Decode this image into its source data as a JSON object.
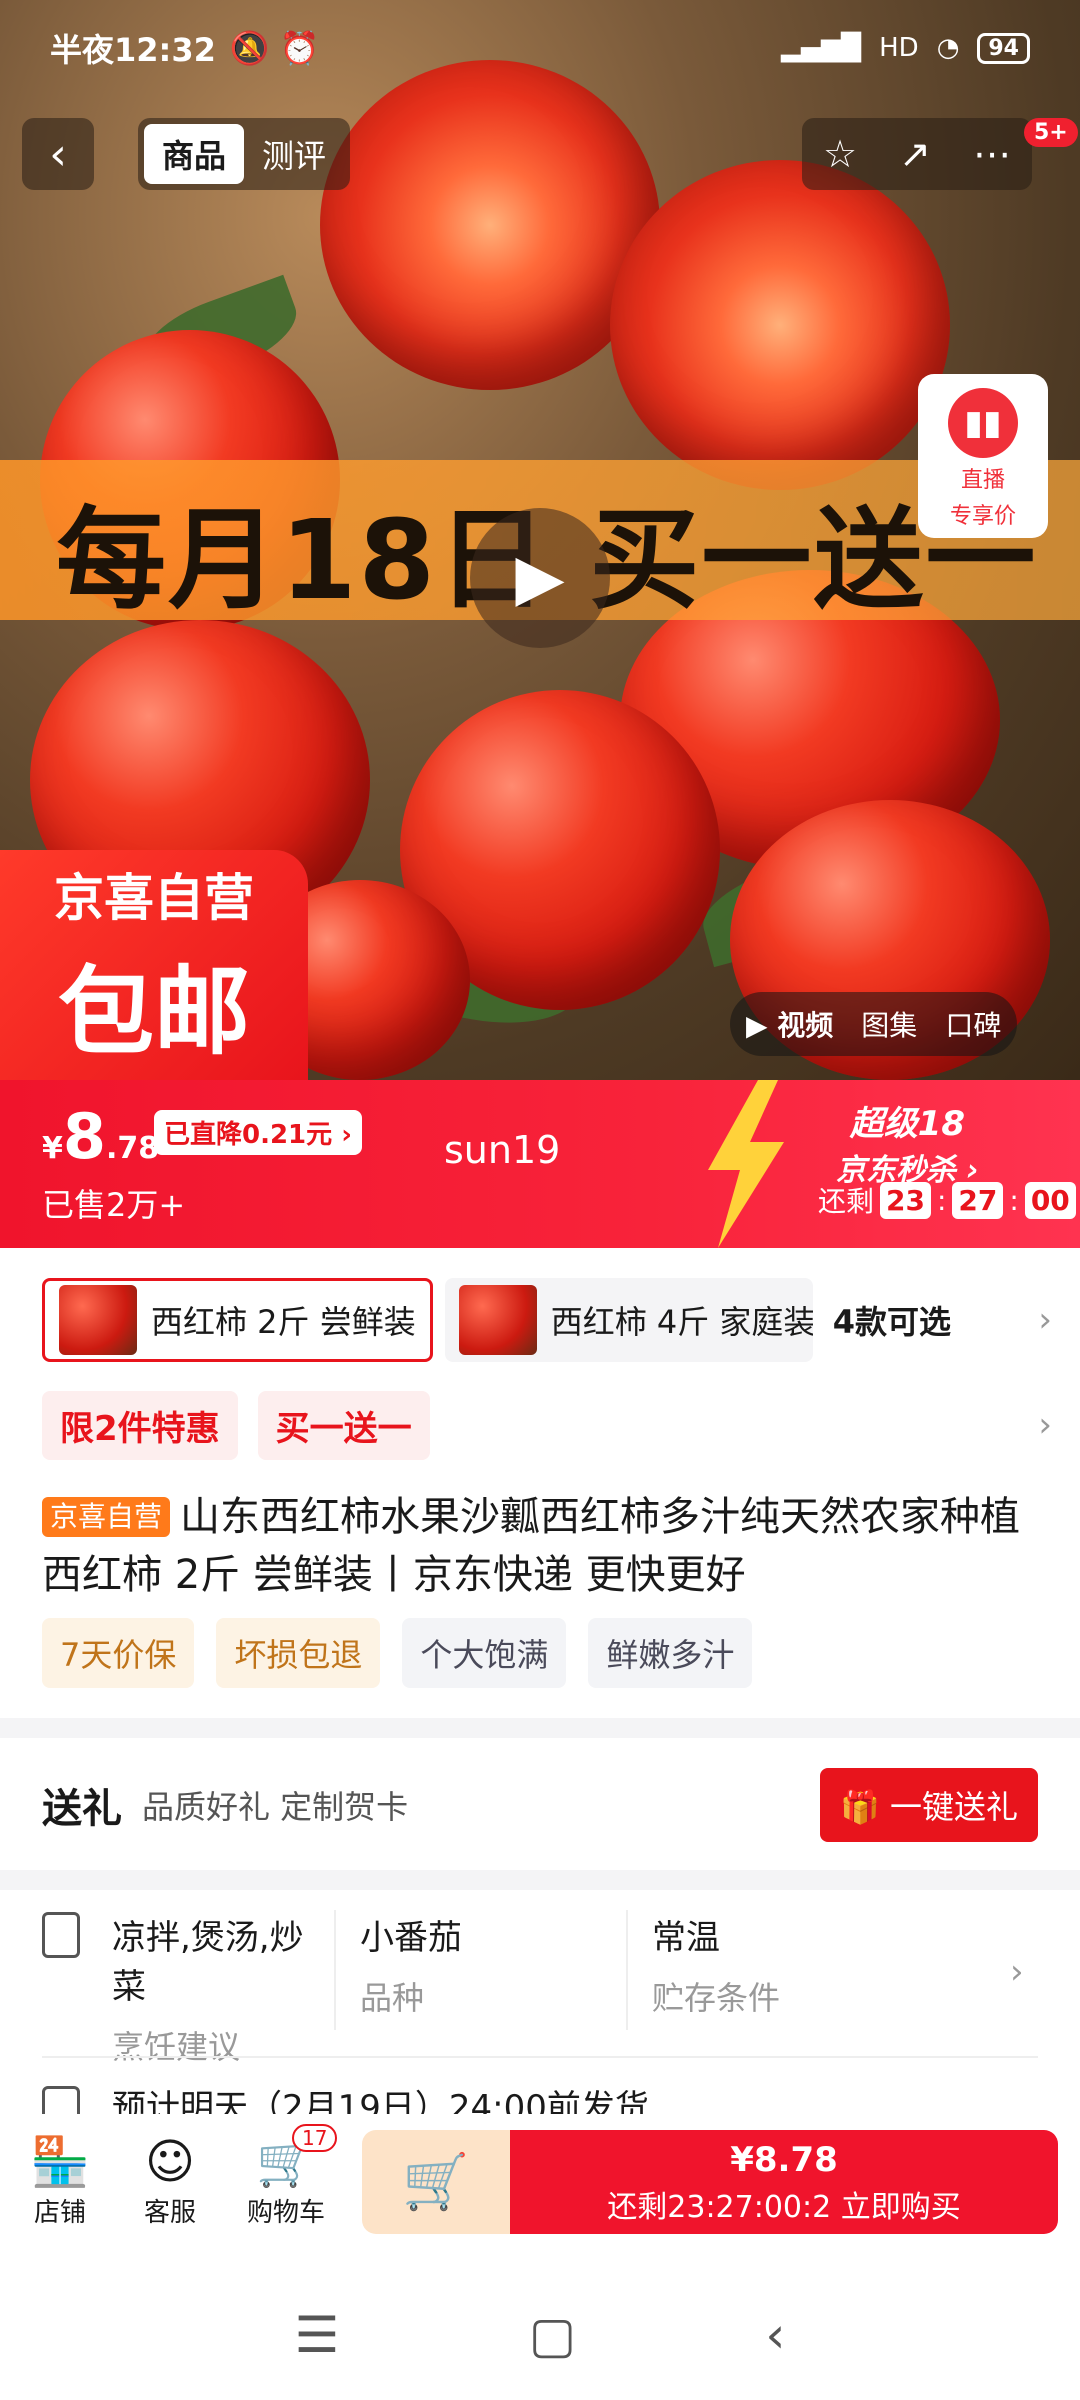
{
  "status_bar": {
    "time": "半夜12:32",
    "battery": "94",
    "signal": "HD"
  },
  "nav": {
    "back": "‹",
    "tabs": [
      "商品",
      "测评"
    ],
    "icons": [
      "star-icon",
      "share-icon",
      "more-icon"
    ],
    "more_badge": "5+"
  },
  "hero": {
    "promo_text": "每月18日 买一送一",
    "live_label_1": "直播",
    "live_label_2": "专享价",
    "corner_badge_1": "京喜自营",
    "corner_badge_2": "包邮",
    "media_tabs": [
      "▶ 视频",
      "图集",
      "口碑"
    ]
  },
  "price": {
    "currency": "¥",
    "integer": "8",
    "decimal": ".78",
    "drop": "已直降0.21元 ›",
    "sold": "已售2万+",
    "watermark": "sun19",
    "flash_title_1": "超级18",
    "flash_title_2": "京东秒杀 ›",
    "countdown_label": "还剩",
    "countdown": [
      "23",
      "27",
      "00"
    ]
  },
  "variants": {
    "selected": "西红柿 2斤 尝鲜装",
    "other": "西红柿 4斤 家庭装",
    "count": "4款可选"
  },
  "deals": [
    "限2件特惠",
    "买一送一"
  ],
  "product": {
    "tag": "京喜自营",
    "title": "山东西红柿水果沙瓤西红柿多汁纯天然农家种植 西红柿 2斤 尝鲜装丨京东快递 更快更好"
  },
  "badges": {
    "warm": [
      "7天价保",
      "坏损包退"
    ],
    "cool": [
      "个大饱满",
      "鲜嫩多汁"
    ]
  },
  "gift": {
    "title": "送礼",
    "subtitle": "品质好礼 定制贺卡",
    "button": "一键送礼"
  },
  "attributes": [
    {
      "value": "凉拌,煲汤,炒菜",
      "label": "烹饪建议"
    },
    {
      "value": "小番茄",
      "label": "品种"
    },
    {
      "value": "常温",
      "label": "贮存条件"
    }
  ],
  "shipping": "预计明天（2月19日）24:00前发货",
  "bottom_bar": {
    "shop": "店铺",
    "service": "客服",
    "cart": "购物车",
    "cart_badge": "17",
    "buy_price": "¥8.78",
    "buy_countdown": "还剩23:27:00:2 立即购买"
  }
}
